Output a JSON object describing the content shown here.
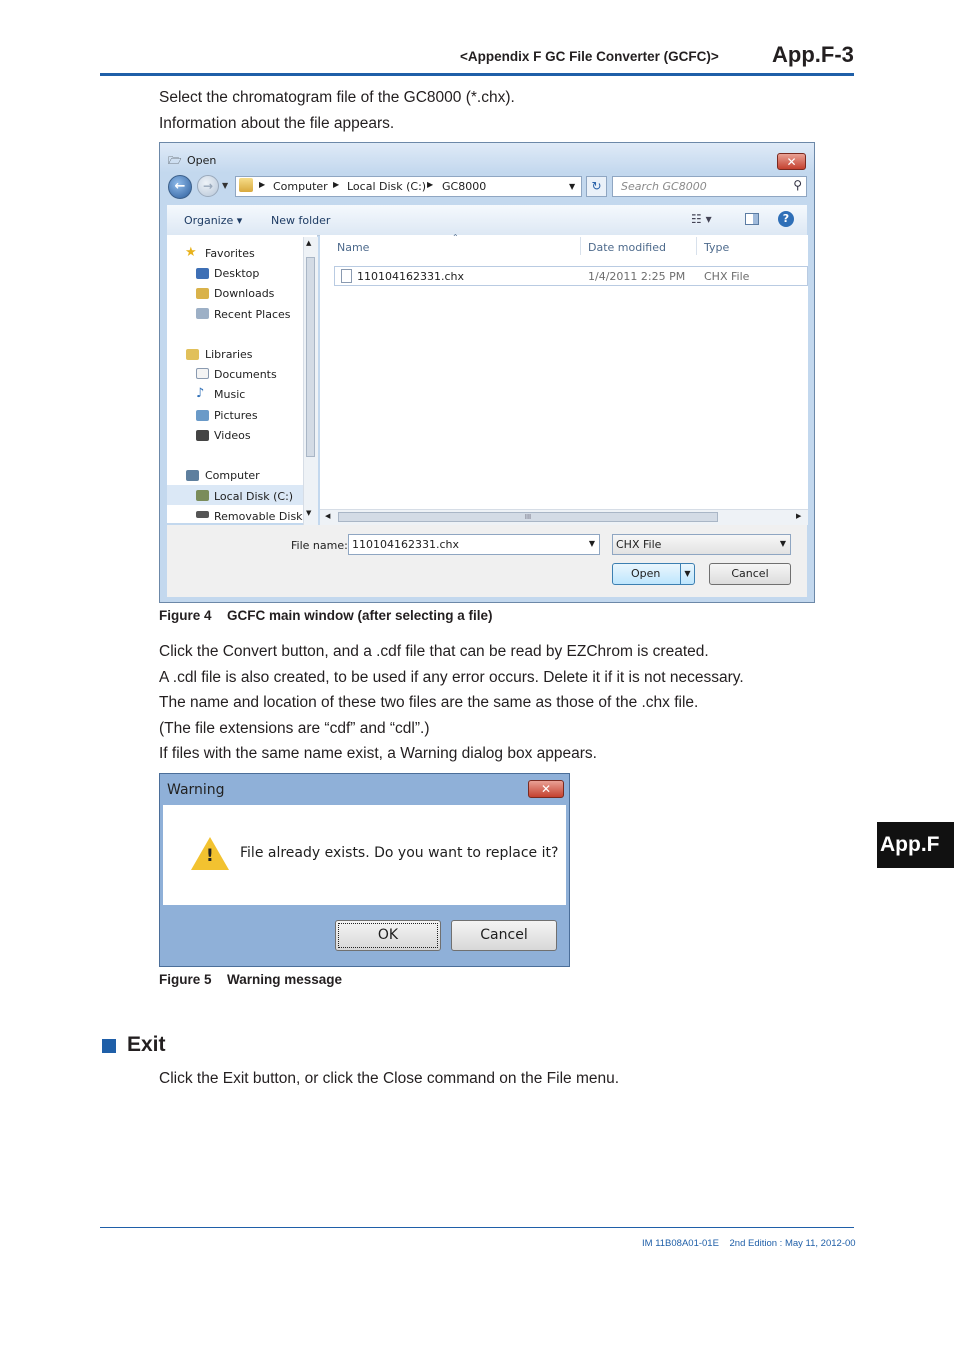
{
  "header": {
    "section": "<Appendix F  GC File Converter (GCFC)>",
    "page": "App.F-3"
  },
  "intro": [
    "Select the chromatogram file of the GC8000 (*.chx).",
    "Information about the file appears."
  ],
  "open_dialog": {
    "title": "Open",
    "close_glyph": "✕",
    "breadcrumb": [
      "Computer",
      "Local Disk (C:)",
      "GC8000"
    ],
    "search_placeholder": "Search GC8000",
    "toolbar": {
      "organize": "Organize ▾",
      "new_folder": "New folder"
    },
    "nav_items": [
      {
        "label": "Favorites"
      },
      {
        "label": "Desktop"
      },
      {
        "label": "Downloads"
      },
      {
        "label": "Recent Places"
      },
      {
        "label": "Libraries"
      },
      {
        "label": "Documents"
      },
      {
        "label": "Music"
      },
      {
        "label": "Pictures"
      },
      {
        "label": "Videos"
      },
      {
        "label": "Computer"
      },
      {
        "label": "Local Disk (C:)"
      },
      {
        "label": "Removable Disk ("
      }
    ],
    "columns": {
      "name": "Name",
      "date": "Date modified",
      "type": "Type"
    },
    "file": {
      "name": "110104162331.chx",
      "date": "1/4/2011 2:25 PM",
      "type": "CHX File"
    },
    "scroll_grip": "III",
    "file_name_label": "File name:",
    "file_name_value": "110104162331.chx",
    "file_type_value": "CHX File",
    "open_label": "Open",
    "cancel_label": "Cancel"
  },
  "figure4": {
    "num": "Figure 4",
    "title": "GCFC main window (after selecting a file)"
  },
  "convert_paras": [
    "Click the Convert button, and a .cdf file that can be read by EZChrom is created.",
    "A .cdl file is also created, to be used if any error occurs. Delete it if it is not necessary.",
    "The name and location of these two files are the same as those of the .chx file.",
    "(The file extensions are “cdf” and “cdl”.)",
    "If files with the same name exist, a Warning dialog box appears."
  ],
  "warning_dialog": {
    "title": "Warning",
    "message": "File already exists. Do you want to replace it?",
    "ok_label": "OK",
    "cancel_label": "Cancel"
  },
  "figure5": {
    "num": "Figure 5",
    "title": "Warning message"
  },
  "side_tab": "App.F",
  "exit": {
    "title": "Exit",
    "text": "Click the Exit button, or click the Close command on the File menu."
  },
  "footer": {
    "doc": "IM 11B08A01-01E",
    "edition": "2nd Edition : May 11, 2012-00"
  }
}
